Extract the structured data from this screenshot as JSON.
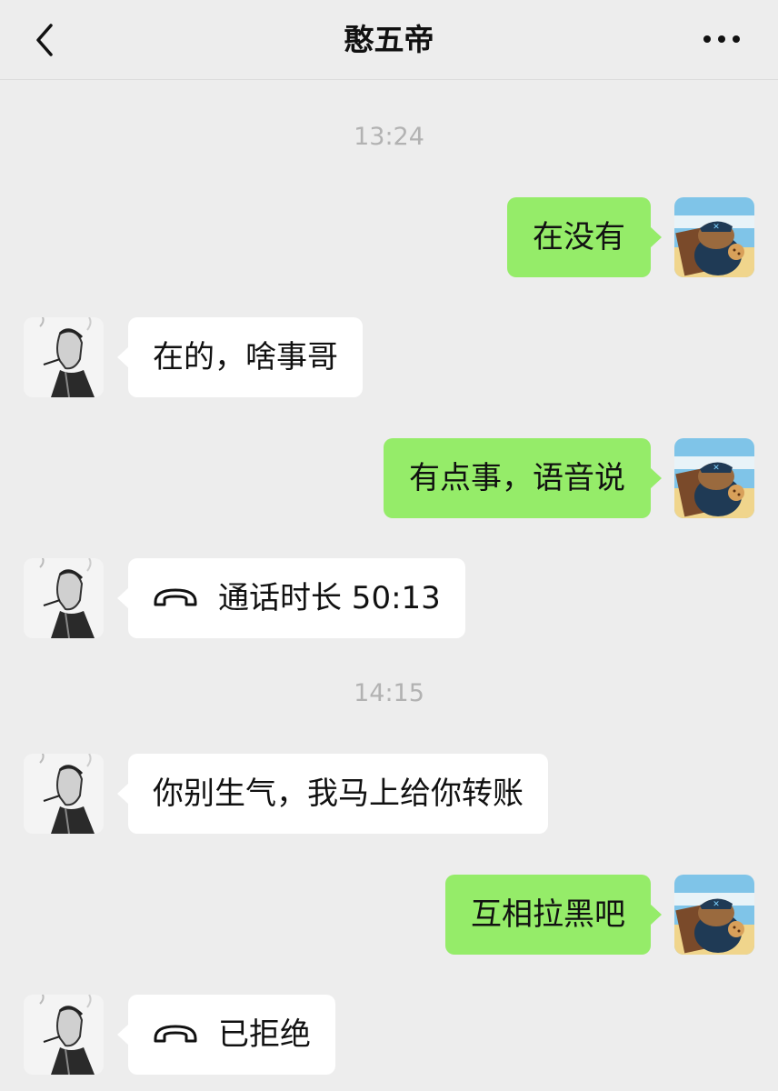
{
  "header": {
    "title": "憨五帝",
    "back_icon": "chevron-left-icon",
    "more_icon": "more-dots-icon"
  },
  "messages": [
    {
      "type": "time",
      "text": "13:24"
    },
    {
      "type": "text",
      "side": "out",
      "text": "在没有"
    },
    {
      "type": "text",
      "side": "in",
      "text": "在的，啥事哥"
    },
    {
      "type": "text",
      "side": "out",
      "text": "有点事，语音说"
    },
    {
      "type": "call",
      "side": "in",
      "icon": "phone-hangup-icon",
      "text": "通话时长 50:13"
    },
    {
      "type": "time",
      "text": "14:15"
    },
    {
      "type": "text",
      "side": "in",
      "text": "你别生气，我马上给你转账"
    },
    {
      "type": "text",
      "side": "out",
      "text": "互相拉黑吧"
    },
    {
      "type": "call",
      "side": "in",
      "icon": "phone-hangup-icon",
      "text": "已拒绝"
    }
  ],
  "colors": {
    "background": "#ededed",
    "outgoing_bubble": "#95ec69",
    "incoming_bubble": "#ffffff",
    "timestamp_text": "#b2b2b2"
  }
}
